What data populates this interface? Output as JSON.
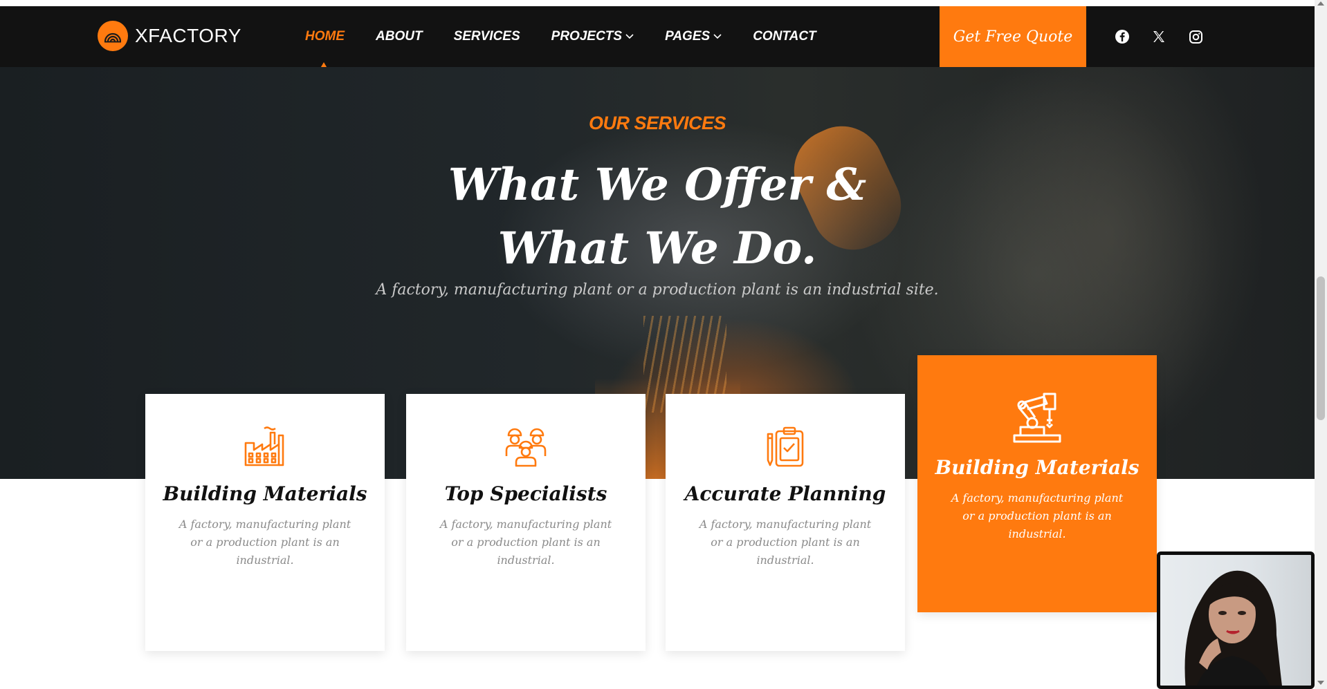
{
  "brand": {
    "name": "XFACTORY"
  },
  "nav": {
    "items": [
      {
        "label": "HOME",
        "active": true,
        "dropdown": false
      },
      {
        "label": "ABOUT",
        "active": false,
        "dropdown": false
      },
      {
        "label": "SERVICES",
        "active": false,
        "dropdown": false
      },
      {
        "label": "PROJECTS",
        "active": false,
        "dropdown": true
      },
      {
        "label": "PAGES",
        "active": false,
        "dropdown": true
      },
      {
        "label": "CONTACT",
        "active": false,
        "dropdown": false
      }
    ],
    "cta": "Get Free Quote",
    "socials": [
      "facebook-icon",
      "x-twitter-icon",
      "instagram-icon"
    ]
  },
  "hero": {
    "eyebrow": "OUR SERVICES",
    "headline_line1": "What We Offer &",
    "headline_line2": "What We Do.",
    "subline": "A factory, manufacturing plant or a production plant is an industrial site."
  },
  "services": [
    {
      "icon": "factory-icon",
      "title": "Building Materials",
      "text": "A factory, manufacturing plant or a production plant is an industrial."
    },
    {
      "icon": "team-workers-icon",
      "title": "Top Specialists",
      "text": "A factory, manufacturing plant or a production plant is an industrial."
    },
    {
      "icon": "clipboard-plan-icon",
      "title": "Accurate Planning",
      "text": "A factory, manufacturing plant or a production plant is an industrial."
    },
    {
      "icon": "robot-arm-icon",
      "title": "Building Materials",
      "text": "A factory, manufacturing plant or a production plant is an industrial.",
      "highlighted": true
    }
  ],
  "colors": {
    "accent": "#ff7a0f",
    "header_bg": "#121212",
    "card_text": "#8a8a8a"
  }
}
